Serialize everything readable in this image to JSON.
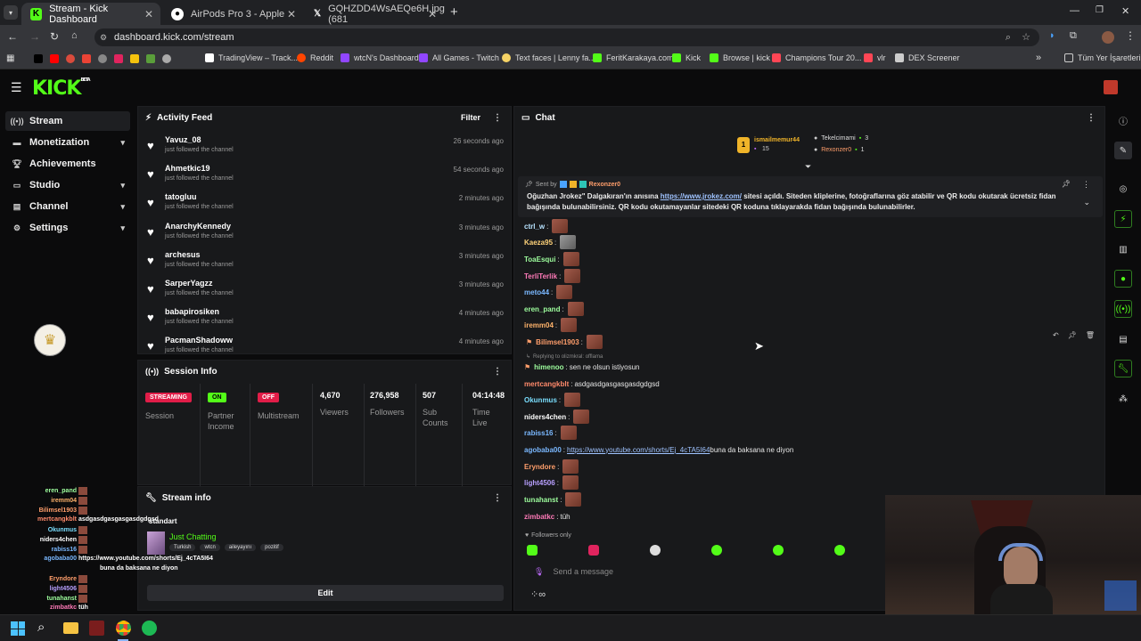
{
  "browser": {
    "tabs": [
      {
        "title": "Stream - Kick Dashboard",
        "icon": "kick-icon"
      },
      {
        "title": "AirPods Pro 3 - Apple",
        "icon": "apple-icon"
      },
      {
        "title": "GQHZDD4WsAEQe6H.jpg (681",
        "icon": "x-icon"
      }
    ],
    "new_tab": "+",
    "url": "dashboard.kick.com/stream",
    "bookmarks": [
      "TradingView – Track...",
      "Reddit",
      "wtcN's Dashboard",
      "All Games - Twitch",
      "Text faces | Lenny fa...",
      "FeritKarakaya.com",
      "Kick",
      "Browse | kick",
      "Champions Tour 20...",
      "vlr",
      "DEX Screener"
    ],
    "all_bookmarks": "Tüm Yer İşaretleri"
  },
  "app": {
    "logo": "KICK",
    "logo_badge": "BETA"
  },
  "sidebar": {
    "items": [
      {
        "label": "Stream"
      },
      {
        "label": "Monetization"
      },
      {
        "label": "Achievements"
      },
      {
        "label": "Studio"
      },
      {
        "label": "Channel"
      },
      {
        "label": "Settings"
      }
    ],
    "chevron": "▾"
  },
  "activity": {
    "title": "Activity Feed",
    "filter": "Filter",
    "items": [
      {
        "name": "Yavuz_08",
        "sub": "just followed the channel",
        "time": "26 seconds ago"
      },
      {
        "name": "Ahmetkic19",
        "sub": "just followed the channel",
        "time": "54 seconds ago"
      },
      {
        "name": "tatogluu",
        "sub": "just followed the channel",
        "time": "2 minutes ago"
      },
      {
        "name": "AnarchyKennedy",
        "sub": "just followed the channel",
        "time": "3 minutes ago"
      },
      {
        "name": "archesus",
        "sub": "just followed the channel",
        "time": "3 minutes ago"
      },
      {
        "name": "SarperYagzz",
        "sub": "just followed the channel",
        "time": "3 minutes ago"
      },
      {
        "name": "babapirosiken",
        "sub": "just followed the channel",
        "time": "4 minutes ago"
      },
      {
        "name": "PacmanShadoww",
        "sub": "just followed the channel",
        "time": "4 minutes ago"
      }
    ]
  },
  "session": {
    "title": "Session Info",
    "status": {
      "badge": "STREAMING",
      "label": "Session"
    },
    "partner": {
      "badge": "ON",
      "label": "Partner Income"
    },
    "multistream": {
      "badge": "OFF",
      "label": "Multistream"
    },
    "viewers": {
      "value": "4,670",
      "label": "Viewers"
    },
    "followers": {
      "value": "276,958",
      "label": "Followers"
    },
    "subs": {
      "value": "507",
      "label": "Sub Counts"
    },
    "time": {
      "value": "04:14:48",
      "label": "Time Live"
    }
  },
  "stream_info": {
    "title": "Stream info",
    "stream_title": "standart",
    "category": "Just Chatting",
    "tags": [
      "Turkish",
      "wtcn",
      "aileyayını",
      "pozitif"
    ],
    "edit": "Edit"
  },
  "chat": {
    "title": "Chat",
    "top_gifter": {
      "rank": "1",
      "name": "ismailmemur44",
      "count": "15"
    },
    "gifters": [
      {
        "name": "Tekelcimami",
        "count": "3"
      },
      {
        "name": "Rexonzer0",
        "count": "1"
      }
    ],
    "pinned": {
      "sent_by_label": "Sent by",
      "sent_by": "Rexonzer0",
      "pre": "Oğuzhan Jrokez\" Dalgakıran'ın anısına ",
      "link": "https://www.jrokez.com/",
      "post": " sitesi açıldı. Siteden kliplerine, fotoğraflarına göz atabilir ve QR kodu okutarak ücretsiz fidan bağışında bulunabilirsiniz. QR kodu okutamayanlar sitedeki QR koduna tıklayarakda fidan bağışında bulunabilirler."
    },
    "messages": [
      {
        "user": "ctrl_w",
        "color": "#b8e3ff",
        "text": ""
      },
      {
        "user": "Kaeza95",
        "color": "#ffd37a",
        "text": ""
      },
      {
        "user": "ToaEsqui",
        "color": "#9eff9e",
        "text": ""
      },
      {
        "user": "TerliTerlik",
        "color": "#ff7ab8",
        "text": ""
      },
      {
        "user": "meto44",
        "color": "#7ab8ff",
        "text": ""
      },
      {
        "user": "eren_pand",
        "color": "#9eff9e",
        "text": ""
      },
      {
        "user": "iremm04",
        "color": "#ffb36b",
        "text": ""
      },
      {
        "user": "Bilimsel1903",
        "color": "#ff9e6b",
        "text": ""
      },
      {
        "user": "himenoo",
        "color": "#9eff9e",
        "text": "sen ne olsun istiyosun"
      },
      {
        "user": "mertcangkblt",
        "color": "#ff8a6b",
        "text": "asdgasdgasgasgasdgdgsd"
      },
      {
        "user": "Okunmus",
        "color": "#7adfff",
        "text": ""
      },
      {
        "user": "niders4chen",
        "color": "#ffffff",
        "text": ""
      },
      {
        "user": "rabiss16",
        "color": "#7ab8ff",
        "text": ""
      },
      {
        "user": "agobaba00",
        "color": "#7ab8ff",
        "link": "https://www.youtube.com/shorts/Ej_4cTA5I64",
        "text": " buna da baksana ne diyon"
      },
      {
        "user": "Eryndore",
        "color": "#ff9e6b",
        "text": ""
      },
      {
        "user": "light4506",
        "color": "#b8a0ff",
        "text": ""
      },
      {
        "user": "tunahanst",
        "color": "#9eff9e",
        "text": ""
      },
      {
        "user": "zimbatkc",
        "color": "#ff7ab8",
        "text": "tüh"
      }
    ],
    "reply": "Replying to olizmkral: offlama",
    "followers_only": "Followers only",
    "input_placeholder": "Send a message"
  },
  "overlay": {
    "lines": [
      {
        "user": "eren_pand",
        "color": "#9eff9e"
      },
      {
        "user": "iremm04",
        "color": "#ffb36b"
      },
      {
        "user": "Bilimsel1903",
        "color": "#ff9e6b"
      },
      {
        "user": "mertcangkblt",
        "color": "#ff8a6b",
        "text": "asdgasdgasgasgasdgdgsd"
      },
      {
        "user": "Okunmus",
        "color": "#7adfff"
      },
      {
        "user": "niders4chen",
        "color": "#ffffff"
      },
      {
        "user": "rabiss16",
        "color": "#7ab8ff"
      },
      {
        "user": "agobaba00",
        "color": "#7ab8ff",
        "text": "https://www.youtube.com/shorts/Ej_4cTA5I64"
      },
      {
        "user": "",
        "color": "#ffffff",
        "text": "buna da baksana ne diyon"
      },
      {
        "user": "Eryndore",
        "color": "#ff9e6b"
      },
      {
        "user": "light4506",
        "color": "#b8a0ff"
      },
      {
        "user": "tunahanst",
        "color": "#9eff9e"
      },
      {
        "user": "zimbatkc",
        "color": "#ff7ab8",
        "text": "tüh"
      }
    ]
  },
  "colors": {
    "accent": "#53fc18",
    "streaming": "#e11d48",
    "bg": "#0b0b0c",
    "panel": "#18191b"
  }
}
